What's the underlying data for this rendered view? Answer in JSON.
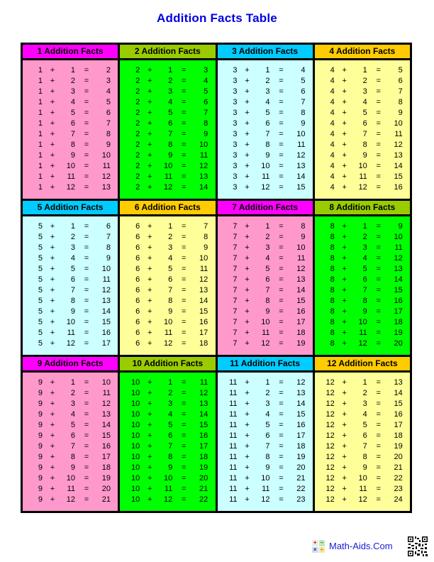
{
  "title": "Addition Facts Table",
  "colors": {
    "title": "#0000e6",
    "header_colors": [
      "#ff00ff",
      "#99cc00",
      "#00ccff",
      "#ffcc00"
    ],
    "body_colors": [
      "#ff99cc",
      "#00ff00",
      "#ccffff",
      "#ffff99"
    ]
  },
  "panels": [
    {
      "header": "1 Addition Facts",
      "header_color": "#ff00ff",
      "body_color": "#ff99cc",
      "facts": [
        [
          "1",
          "+",
          "1",
          "=",
          "2"
        ],
        [
          "1",
          "+",
          "2",
          "=",
          "3"
        ],
        [
          "1",
          "+",
          "3",
          "=",
          "4"
        ],
        [
          "1",
          "+",
          "4",
          "=",
          "5"
        ],
        [
          "1",
          "+",
          "5",
          "=",
          "6"
        ],
        [
          "1",
          "+",
          "6",
          "=",
          "7"
        ],
        [
          "1",
          "+",
          "7",
          "=",
          "8"
        ],
        [
          "1",
          "+",
          "8",
          "=",
          "9"
        ],
        [
          "1",
          "+",
          "9",
          "=",
          "10"
        ],
        [
          "1",
          "+",
          "10",
          "=",
          "11"
        ],
        [
          "1",
          "+",
          "11",
          "=",
          "12"
        ],
        [
          "1",
          "+",
          "12",
          "=",
          "13"
        ]
      ]
    },
    {
      "header": "2 Addition Facts",
      "header_color": "#99cc00",
      "body_color": "#00ff00",
      "facts": [
        [
          "2",
          "+",
          "1",
          "=",
          "3"
        ],
        [
          "2",
          "+",
          "2",
          "=",
          "4"
        ],
        [
          "2",
          "+",
          "3",
          "=",
          "5"
        ],
        [
          "2",
          "+",
          "4",
          "=",
          "6"
        ],
        [
          "2",
          "+",
          "5",
          "=",
          "7"
        ],
        [
          "2",
          "+",
          "6",
          "=",
          "8"
        ],
        [
          "2",
          "+",
          "7",
          "=",
          "9"
        ],
        [
          "2",
          "+",
          "8",
          "=",
          "10"
        ],
        [
          "2",
          "+",
          "9",
          "=",
          "11"
        ],
        [
          "2",
          "+",
          "10",
          "=",
          "12"
        ],
        [
          "2",
          "+",
          "11",
          "=",
          "13"
        ],
        [
          "2",
          "+",
          "12",
          "=",
          "14"
        ]
      ]
    },
    {
      "header": "3 Addition Facts",
      "header_color": "#00ccff",
      "body_color": "#ccffff",
      "facts": [
        [
          "3",
          "+",
          "1",
          "=",
          "4"
        ],
        [
          "3",
          "+",
          "2",
          "=",
          "5"
        ],
        [
          "3",
          "+",
          "3",
          "=",
          "6"
        ],
        [
          "3",
          "+",
          "4",
          "=",
          "7"
        ],
        [
          "3",
          "+",
          "5",
          "=",
          "8"
        ],
        [
          "3",
          "+",
          "6",
          "=",
          "9"
        ],
        [
          "3",
          "+",
          "7",
          "=",
          "10"
        ],
        [
          "3",
          "+",
          "8",
          "=",
          "11"
        ],
        [
          "3",
          "+",
          "9",
          "=",
          "12"
        ],
        [
          "3",
          "+",
          "10",
          "=",
          "13"
        ],
        [
          "3",
          "+",
          "11",
          "=",
          "14"
        ],
        [
          "3",
          "+",
          "12",
          "=",
          "15"
        ]
      ]
    },
    {
      "header": "4 Addition Facts",
      "header_color": "#ffcc00",
      "body_color": "#ffff99",
      "facts": [
        [
          "4",
          "+",
          "1",
          "=",
          "5"
        ],
        [
          "4",
          "+",
          "2",
          "=",
          "6"
        ],
        [
          "4",
          "+",
          "3",
          "=",
          "7"
        ],
        [
          "4",
          "+",
          "4",
          "=",
          "8"
        ],
        [
          "4",
          "+",
          "5",
          "=",
          "9"
        ],
        [
          "4",
          "+",
          "6",
          "=",
          "10"
        ],
        [
          "4",
          "+",
          "7",
          "=",
          "11"
        ],
        [
          "4",
          "+",
          "8",
          "=",
          "12"
        ],
        [
          "4",
          "+",
          "9",
          "=",
          "13"
        ],
        [
          "4",
          "+",
          "10",
          "=",
          "14"
        ],
        [
          "4",
          "+",
          "11",
          "=",
          "15"
        ],
        [
          "4",
          "+",
          "12",
          "=",
          "16"
        ]
      ]
    },
    {
      "header": "5 Addition Facts",
      "header_color": "#00ccff",
      "body_color": "#ccffff",
      "facts": [
        [
          "5",
          "+",
          "1",
          "=",
          "6"
        ],
        [
          "5",
          "+",
          "2",
          "=",
          "7"
        ],
        [
          "5",
          "+",
          "3",
          "=",
          "8"
        ],
        [
          "5",
          "+",
          "4",
          "=",
          "9"
        ],
        [
          "5",
          "+",
          "5",
          "=",
          "10"
        ],
        [
          "5",
          "+",
          "6",
          "=",
          "11"
        ],
        [
          "5",
          "+",
          "7",
          "=",
          "12"
        ],
        [
          "5",
          "+",
          "8",
          "=",
          "13"
        ],
        [
          "5",
          "+",
          "9",
          "=",
          "14"
        ],
        [
          "5",
          "+",
          "10",
          "=",
          "15"
        ],
        [
          "5",
          "+",
          "11",
          "=",
          "16"
        ],
        [
          "5",
          "+",
          "12",
          "=",
          "17"
        ]
      ]
    },
    {
      "header": "6 Addition Facts",
      "header_color": "#ffcc00",
      "body_color": "#ffff99",
      "facts": [
        [
          "6",
          "+",
          "1",
          "=",
          "7"
        ],
        [
          "6",
          "+",
          "2",
          "=",
          "8"
        ],
        [
          "6",
          "+",
          "3",
          "=",
          "9"
        ],
        [
          "6",
          "+",
          "4",
          "=",
          "10"
        ],
        [
          "6",
          "+",
          "5",
          "=",
          "11"
        ],
        [
          "6",
          "+",
          "6",
          "=",
          "12"
        ],
        [
          "6",
          "+",
          "7",
          "=",
          "13"
        ],
        [
          "6",
          "+",
          "8",
          "=",
          "14"
        ],
        [
          "6",
          "+",
          "9",
          "=",
          "15"
        ],
        [
          "6",
          "+",
          "10",
          "=",
          "16"
        ],
        [
          "6",
          "+",
          "11",
          "=",
          "17"
        ],
        [
          "6",
          "+",
          "12",
          "=",
          "18"
        ]
      ]
    },
    {
      "header": "7 Addition Facts",
      "header_color": "#ff00ff",
      "body_color": "#ff99cc",
      "facts": [
        [
          "7",
          "+",
          "1",
          "=",
          "8"
        ],
        [
          "7",
          "+",
          "2",
          "=",
          "9"
        ],
        [
          "7",
          "+",
          "3",
          "=",
          "10"
        ],
        [
          "7",
          "+",
          "4",
          "=",
          "11"
        ],
        [
          "7",
          "+",
          "5",
          "=",
          "12"
        ],
        [
          "7",
          "+",
          "6",
          "=",
          "13"
        ],
        [
          "7",
          "+",
          "7",
          "=",
          "14"
        ],
        [
          "7",
          "+",
          "8",
          "=",
          "15"
        ],
        [
          "7",
          "+",
          "9",
          "=",
          "16"
        ],
        [
          "7",
          "+",
          "10",
          "=",
          "17"
        ],
        [
          "7",
          "+",
          "11",
          "=",
          "18"
        ],
        [
          "7",
          "+",
          "12",
          "=",
          "19"
        ]
      ]
    },
    {
      "header": "8 Addition Facts",
      "header_color": "#99cc00",
      "body_color": "#00ff00",
      "facts": [
        [
          "8",
          "+",
          "1",
          "=",
          "9"
        ],
        [
          "8",
          "+",
          "2",
          "=",
          "10"
        ],
        [
          "8",
          "+",
          "3",
          "=",
          "11"
        ],
        [
          "8",
          "+",
          "4",
          "=",
          "12"
        ],
        [
          "8",
          "+",
          "5",
          "=",
          "13"
        ],
        [
          "8",
          "+",
          "6",
          "=",
          "14"
        ],
        [
          "8",
          "+",
          "7",
          "=",
          "15"
        ],
        [
          "8",
          "+",
          "8",
          "=",
          "16"
        ],
        [
          "8",
          "+",
          "9",
          "=",
          "17"
        ],
        [
          "8",
          "+",
          "10",
          "=",
          "18"
        ],
        [
          "8",
          "+",
          "11",
          "=",
          "19"
        ],
        [
          "8",
          "+",
          "12",
          "=",
          "20"
        ]
      ]
    },
    {
      "header": "9 Addition Facts",
      "header_color": "#ff00ff",
      "body_color": "#ff99cc",
      "facts": [
        [
          "9",
          "+",
          "1",
          "=",
          "10"
        ],
        [
          "9",
          "+",
          "2",
          "=",
          "11"
        ],
        [
          "9",
          "+",
          "3",
          "=",
          "12"
        ],
        [
          "9",
          "+",
          "4",
          "=",
          "13"
        ],
        [
          "9",
          "+",
          "5",
          "=",
          "14"
        ],
        [
          "9",
          "+",
          "6",
          "=",
          "15"
        ],
        [
          "9",
          "+",
          "7",
          "=",
          "16"
        ],
        [
          "9",
          "+",
          "8",
          "=",
          "17"
        ],
        [
          "9",
          "+",
          "9",
          "=",
          "18"
        ],
        [
          "9",
          "+",
          "10",
          "=",
          "19"
        ],
        [
          "9",
          "+",
          "11",
          "=",
          "20"
        ],
        [
          "9",
          "+",
          "12",
          "=",
          "21"
        ]
      ]
    },
    {
      "header": "10 Addition Facts",
      "header_color": "#99cc00",
      "body_color": "#00ff00",
      "facts": [
        [
          "10",
          "+",
          "1",
          "=",
          "11"
        ],
        [
          "10",
          "+",
          "2",
          "=",
          "12"
        ],
        [
          "10",
          "+",
          "3",
          "=",
          "13"
        ],
        [
          "10",
          "+",
          "4",
          "=",
          "14"
        ],
        [
          "10",
          "+",
          "5",
          "=",
          "15"
        ],
        [
          "10",
          "+",
          "6",
          "=",
          "16"
        ],
        [
          "10",
          "+",
          "7",
          "=",
          "17"
        ],
        [
          "10",
          "+",
          "8",
          "=",
          "18"
        ],
        [
          "10",
          "+",
          "9",
          "=",
          "19"
        ],
        [
          "10",
          "+",
          "10",
          "=",
          "20"
        ],
        [
          "10",
          "+",
          "11",
          "=",
          "21"
        ],
        [
          "10",
          "+",
          "12",
          "=",
          "22"
        ]
      ]
    },
    {
      "header": "11 Addition Facts",
      "header_color": "#00ccff",
      "body_color": "#ccffff",
      "facts": [
        [
          "11",
          "+",
          "1",
          "=",
          "12"
        ],
        [
          "11",
          "+",
          "2",
          "=",
          "13"
        ],
        [
          "11",
          "+",
          "3",
          "=",
          "14"
        ],
        [
          "11",
          "+",
          "4",
          "=",
          "15"
        ],
        [
          "11",
          "+",
          "5",
          "=",
          "16"
        ],
        [
          "11",
          "+",
          "6",
          "=",
          "17"
        ],
        [
          "11",
          "+",
          "7",
          "=",
          "18"
        ],
        [
          "11",
          "+",
          "8",
          "=",
          "19"
        ],
        [
          "11",
          "+",
          "9",
          "=",
          "20"
        ],
        [
          "11",
          "+",
          "10",
          "=",
          "21"
        ],
        [
          "11",
          "+",
          "11",
          "=",
          "22"
        ],
        [
          "11",
          "+",
          "12",
          "=",
          "23"
        ]
      ]
    },
    {
      "header": "12 Addition Facts",
      "header_color": "#ffcc00",
      "body_color": "#ffff99",
      "facts": [
        [
          "12",
          "+",
          "1",
          "=",
          "13"
        ],
        [
          "12",
          "+",
          "2",
          "=",
          "14"
        ],
        [
          "12",
          "+",
          "3",
          "=",
          "15"
        ],
        [
          "12",
          "+",
          "4",
          "=",
          "16"
        ],
        [
          "12",
          "+",
          "5",
          "=",
          "17"
        ],
        [
          "12",
          "+",
          "6",
          "=",
          "18"
        ],
        [
          "12",
          "+",
          "7",
          "=",
          "19"
        ],
        [
          "12",
          "+",
          "8",
          "=",
          "20"
        ],
        [
          "12",
          "+",
          "9",
          "=",
          "21"
        ],
        [
          "12",
          "+",
          "10",
          "=",
          "22"
        ],
        [
          "12",
          "+",
          "11",
          "=",
          "23"
        ],
        [
          "12",
          "+",
          "12",
          "=",
          "24"
        ]
      ]
    }
  ],
  "footer": {
    "brand": "Math-Aids.Com",
    "logo_icon": "math-operators-icon",
    "logo_symbols": [
      "+",
      "−",
      "×",
      "÷"
    ],
    "qr_icon": "qr-code-icon"
  }
}
